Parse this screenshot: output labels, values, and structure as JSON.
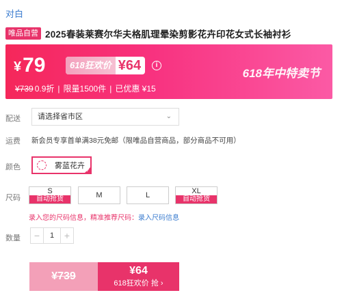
{
  "brand": "对白",
  "product": {
    "tag": "唯品自营",
    "title": "2025春装莱赛尔华夫格肌理晕染剪影花卉印花女式长袖衬衫"
  },
  "price": {
    "symbol": "¥",
    "current": "79",
    "promo_label": "618狂欢价",
    "promo_price": "¥64",
    "info_icon": "i",
    "festival_label": "618年中特卖节",
    "original": "¥739",
    "discount": "0.9折",
    "separator": "|",
    "limit": "限量1500件",
    "saved": "已优惠 ¥15"
  },
  "delivery": {
    "label": "配送",
    "placeholder": "请选择省市区",
    "chevron": "⌄"
  },
  "shipping": {
    "label": "运费",
    "text": "新会员专享首单满38元免邮（限唯品自营商品，部分商品不可用）"
  },
  "color": {
    "label": "颜色",
    "selected": "雾蓝花卉",
    "check": "✓"
  },
  "size": {
    "label": "尺码",
    "options": [
      {
        "name": "S",
        "badge": "自动抢货"
      },
      {
        "name": "M"
      },
      {
        "name": "L"
      },
      {
        "name": "XL",
        "badge": "自动抢货"
      }
    ],
    "note_prefix": "录入您的尺码信息，精准推荐尺码：",
    "note_link": "录入尺码信息"
  },
  "quantity": {
    "label": "数量",
    "minus": "−",
    "value": "1",
    "plus": "+"
  },
  "buy": {
    "original": "¥739",
    "price": "¥64",
    "action": "618狂欢价 抢 ›"
  },
  "colors": {
    "accent": "#e8336a",
    "link": "#3b7ccf",
    "panel_start": "#f5275a",
    "panel_end": "#fb5aa5"
  }
}
